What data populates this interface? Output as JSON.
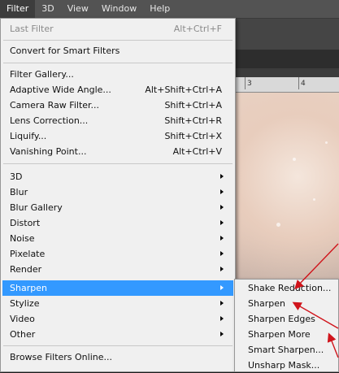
{
  "menubar": {
    "items": [
      {
        "label": "Filter"
      },
      {
        "label": "3D"
      },
      {
        "label": "View"
      },
      {
        "label": "Window"
      },
      {
        "label": "Help"
      }
    ],
    "active_index": 0
  },
  "ruler": {
    "ticks": [
      "3",
      "4"
    ]
  },
  "filter_menu": {
    "last_filter": {
      "label": "Last Filter",
      "shortcut": "Alt+Ctrl+F",
      "disabled": true
    },
    "convert": {
      "label": "Convert for Smart Filters"
    },
    "gallery_items": [
      {
        "label": "Filter Gallery...",
        "shortcut": ""
      },
      {
        "label": "Adaptive Wide Angle...",
        "shortcut": "Alt+Shift+Ctrl+A"
      },
      {
        "label": "Camera Raw Filter...",
        "shortcut": "Shift+Ctrl+A"
      },
      {
        "label": "Lens Correction...",
        "shortcut": "Shift+Ctrl+R"
      },
      {
        "label": "Liquify...",
        "shortcut": "Shift+Ctrl+X"
      },
      {
        "label": "Vanishing Point...",
        "shortcut": "Alt+Ctrl+V"
      }
    ],
    "submenus": [
      {
        "label": "3D"
      },
      {
        "label": "Blur"
      },
      {
        "label": "Blur Gallery"
      },
      {
        "label": "Distort"
      },
      {
        "label": "Noise"
      },
      {
        "label": "Pixelate"
      },
      {
        "label": "Render"
      },
      {
        "label": "Sharpen",
        "selected": true
      },
      {
        "label": "Stylize"
      },
      {
        "label": "Video"
      },
      {
        "label": "Other"
      }
    ],
    "browse": {
      "label": "Browse Filters Online..."
    }
  },
  "sharpen_submenu": {
    "items": [
      {
        "label": "Shake Reduction..."
      },
      {
        "label": "Sharpen"
      },
      {
        "label": "Sharpen Edges"
      },
      {
        "label": "Sharpen More"
      },
      {
        "label": "Smart Sharpen..."
      },
      {
        "label": "Unsharp Mask..."
      }
    ]
  },
  "colors": {
    "selection": "#3399ff",
    "annotation_arrow": "#d0141b",
    "menu_bg": "#f0f0f0",
    "menubar_bg": "#535353"
  }
}
